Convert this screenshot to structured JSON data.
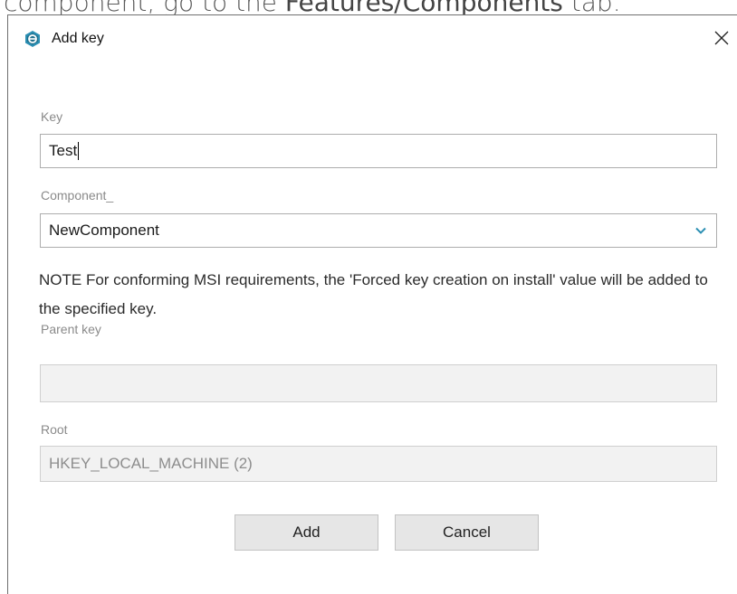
{
  "background_caption": {
    "before": "component, go to the ",
    "link": "Features/Components",
    "after": " tab."
  },
  "dialog": {
    "title": "Add key",
    "app_icon": "app-logo-icon",
    "close_icon": "close-icon",
    "key": {
      "label": "Key",
      "value": "Test"
    },
    "component": {
      "label": "Component_",
      "value": "NewComponent",
      "icon": "chevron-down-icon"
    },
    "note": "NOTE For conforming MSI requirements, the 'Forced key creation on install' value will be added to the specified key.",
    "parent_key": {
      "label": "Parent key",
      "value": ""
    },
    "root": {
      "label": "Root",
      "value": "HKEY_LOCAL_MACHINE (2)"
    },
    "buttons": {
      "add": "Add",
      "cancel": "Cancel"
    }
  },
  "colors": {
    "accent": "#2b8fb3",
    "disabled_bg": "#f2f2f2",
    "button_bg": "#e6e6e6"
  }
}
